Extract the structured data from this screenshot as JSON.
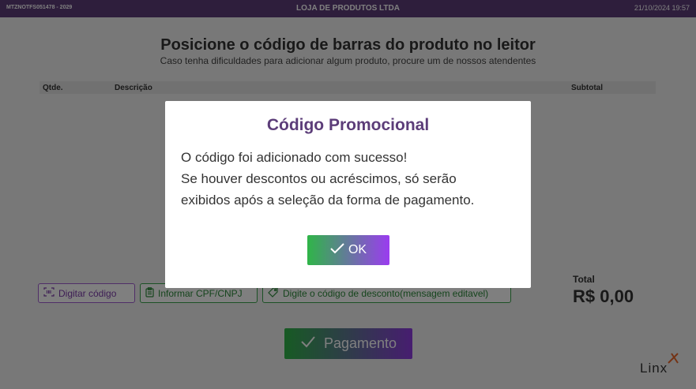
{
  "topbar": {
    "left": "MTZNOTFS051478 - 2029",
    "center": "LOJA DE PRODUTOS LTDA",
    "right": "21/10/2024 19:57"
  },
  "main": {
    "heading": "Posicione o código de barras do produto no leitor",
    "subheading": "Caso tenha dificuldades para adicionar algum produto, procure um de nossos atendentes",
    "table_columns": [
      "Qtde.",
      "Descrição",
      "Subtotal"
    ]
  },
  "actions": {
    "digitar_label": "Digitar código",
    "cpf_label": "Informar CPF/CNPJ",
    "desconto_label": "Digite o código de desconto(mensagem editavel)"
  },
  "total": {
    "label": "Total",
    "value": "R$ 0,00"
  },
  "payment_button": "Pagamento",
  "logo": "Linx",
  "modal": {
    "title": "Código Promocional",
    "lines": [
      "O código foi adicionado com sucesso!",
      "Se houver descontos ou acréscimos, só serão",
      "exibidos após a seleção da forma de pagamento."
    ],
    "ok_label": "OK"
  },
  "colors": {
    "topbar": "#5c3d79",
    "purple_accent": "#8e3be0",
    "green_accent": "#2fb548"
  }
}
